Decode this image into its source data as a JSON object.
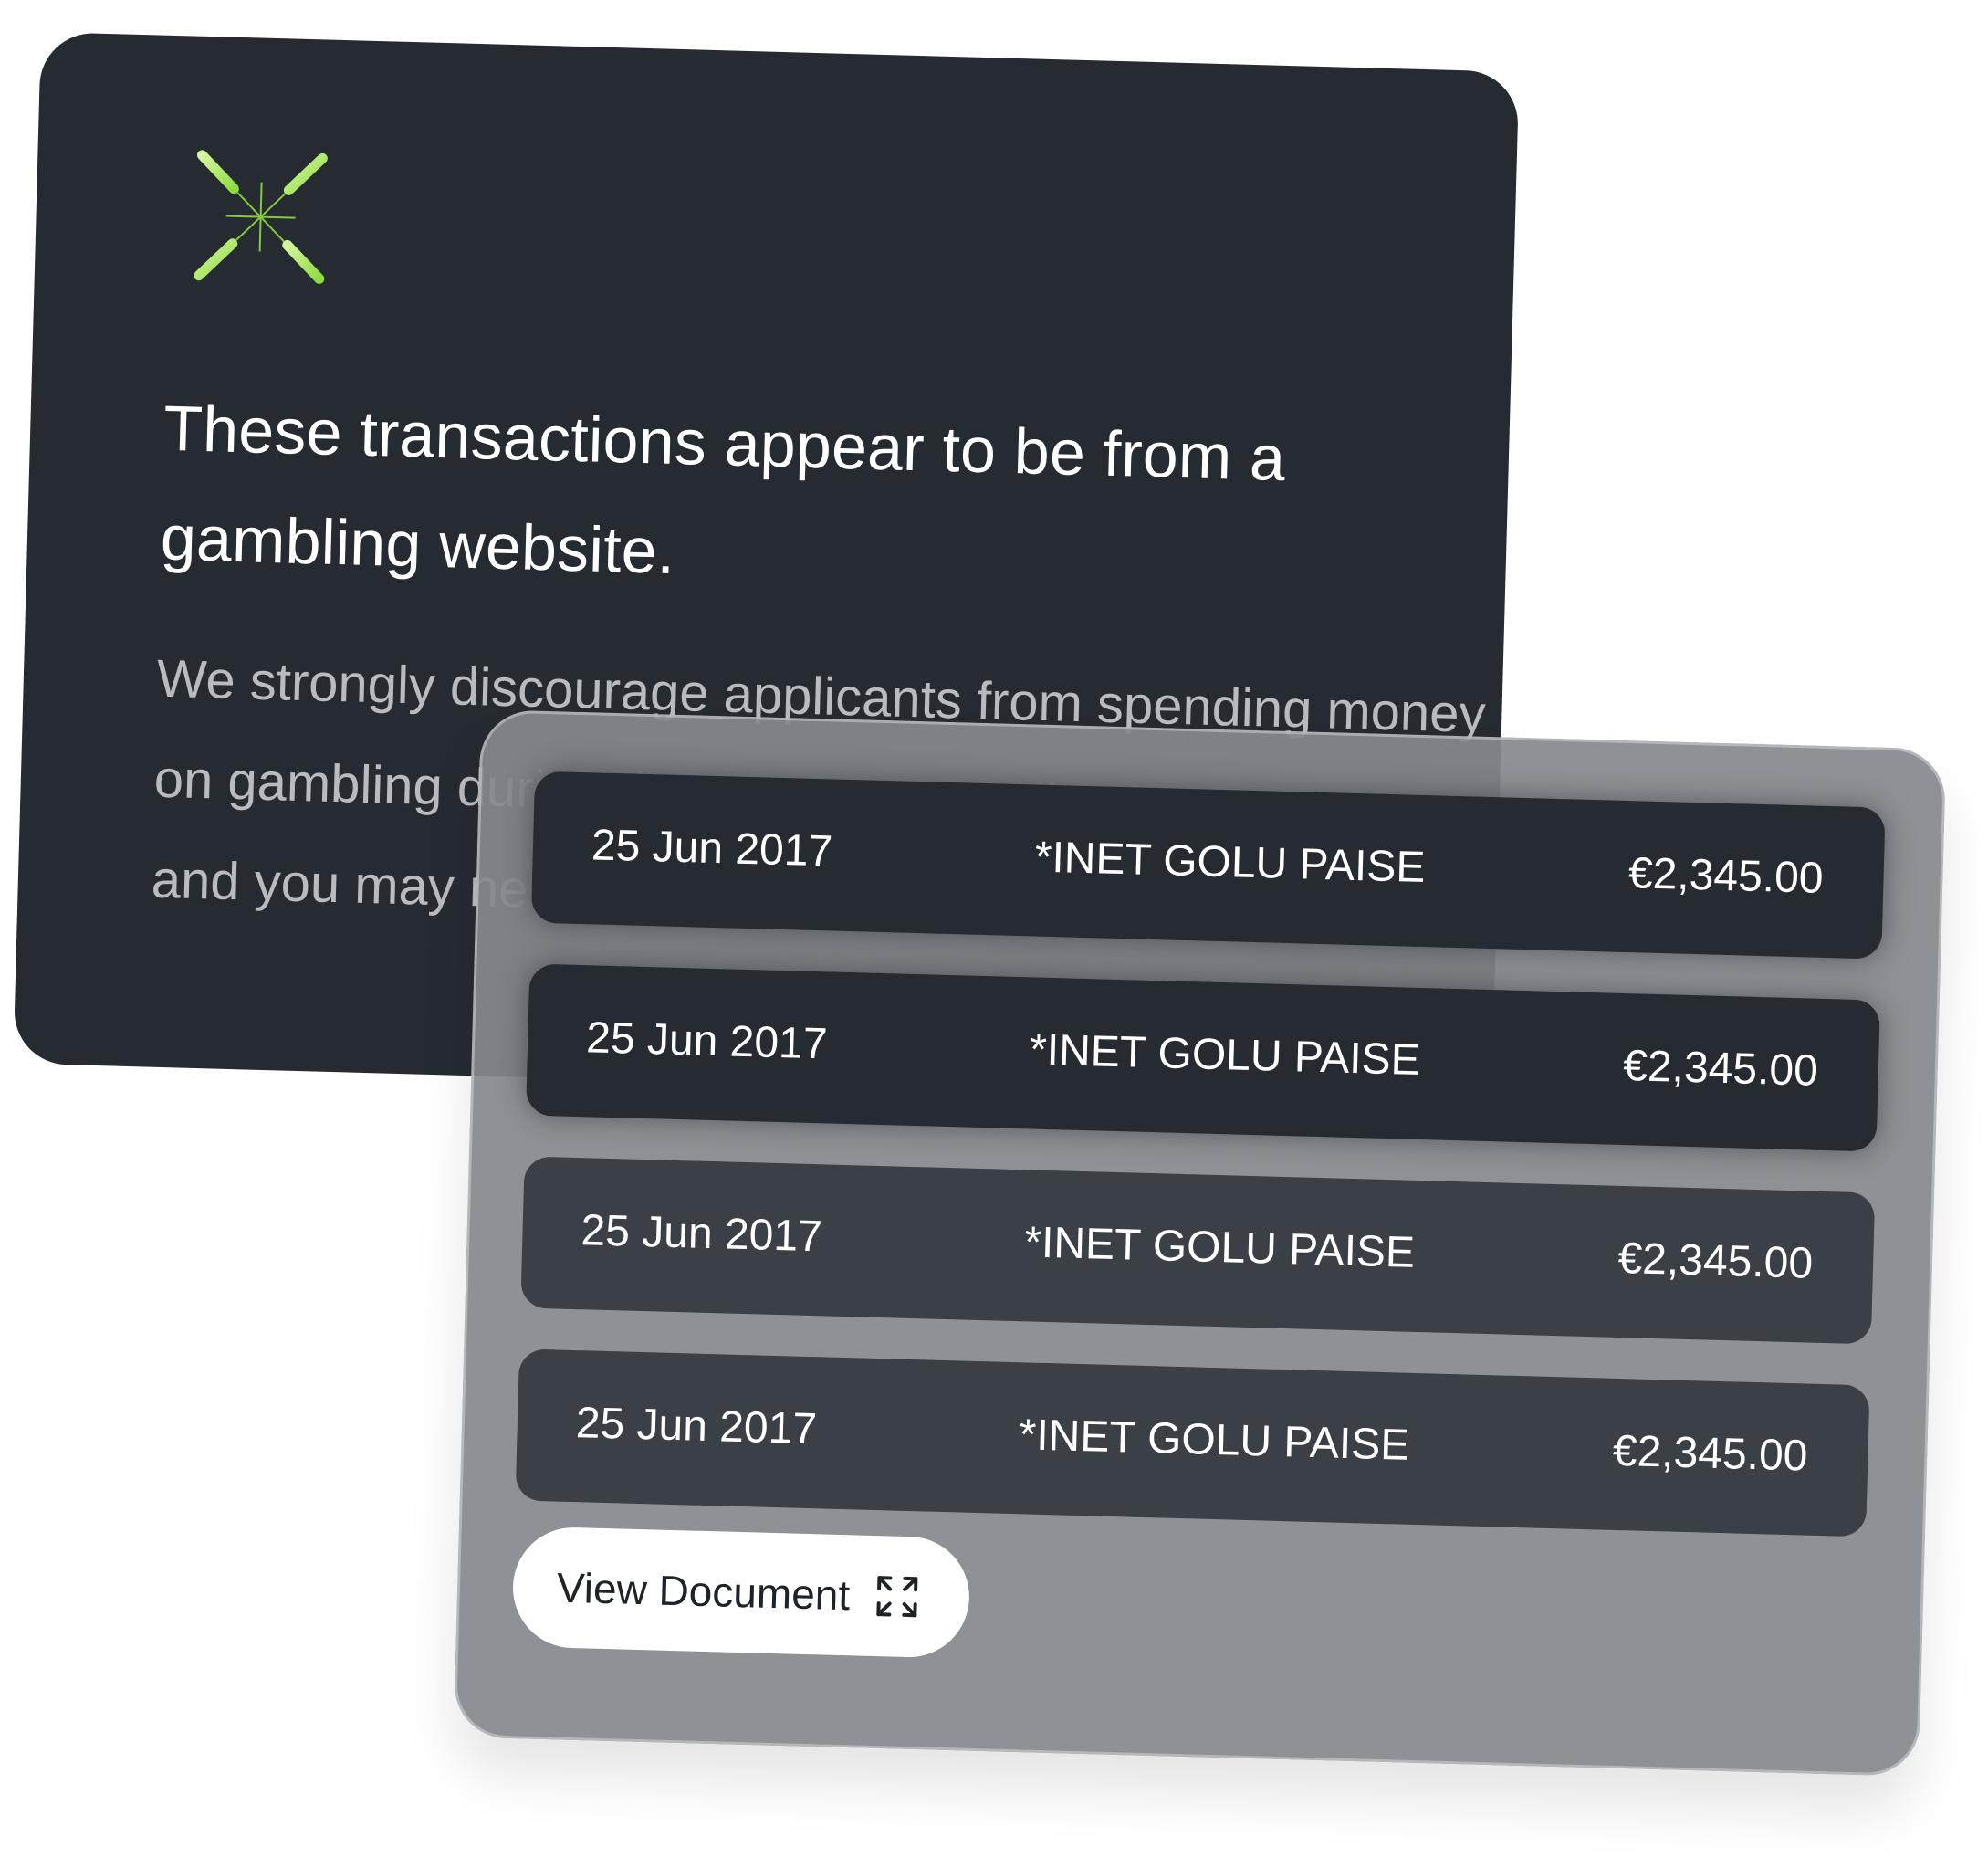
{
  "alert": {
    "icon": "sparkle-burst-icon",
    "title": "These transactions appear to be from a gambling website.",
    "body": "We strongly discourage applicants from spending money on gambling during the mortgage application process and you may need an explanation in writing."
  },
  "colors": {
    "card_dark": "#262b32",
    "panel_grey": "#85898d",
    "row_dark": "#3b3f46",
    "accent_green_light": "#c8f08f",
    "accent_green": "#8edc3e",
    "text_white": "#ffffff",
    "text_muted": "#b8bbbf"
  },
  "transactions": [
    {
      "date": "25 Jun 2017",
      "merchant": "*INET GOLU PAISE",
      "amount": "€2,345.00"
    },
    {
      "date": "25 Jun 2017",
      "merchant": "*INET GOLU PAISE",
      "amount": "€2,345.00"
    },
    {
      "date": "25 Jun 2017",
      "merchant": "*INET GOLU PAISE",
      "amount": "€2,345.00"
    },
    {
      "date": "25 Jun 2017",
      "merchant": "*INET GOLU PAISE",
      "amount": "€2,345.00"
    }
  ],
  "actions": {
    "view_document_label": "View Document",
    "view_document_icon": "expand-icon"
  }
}
